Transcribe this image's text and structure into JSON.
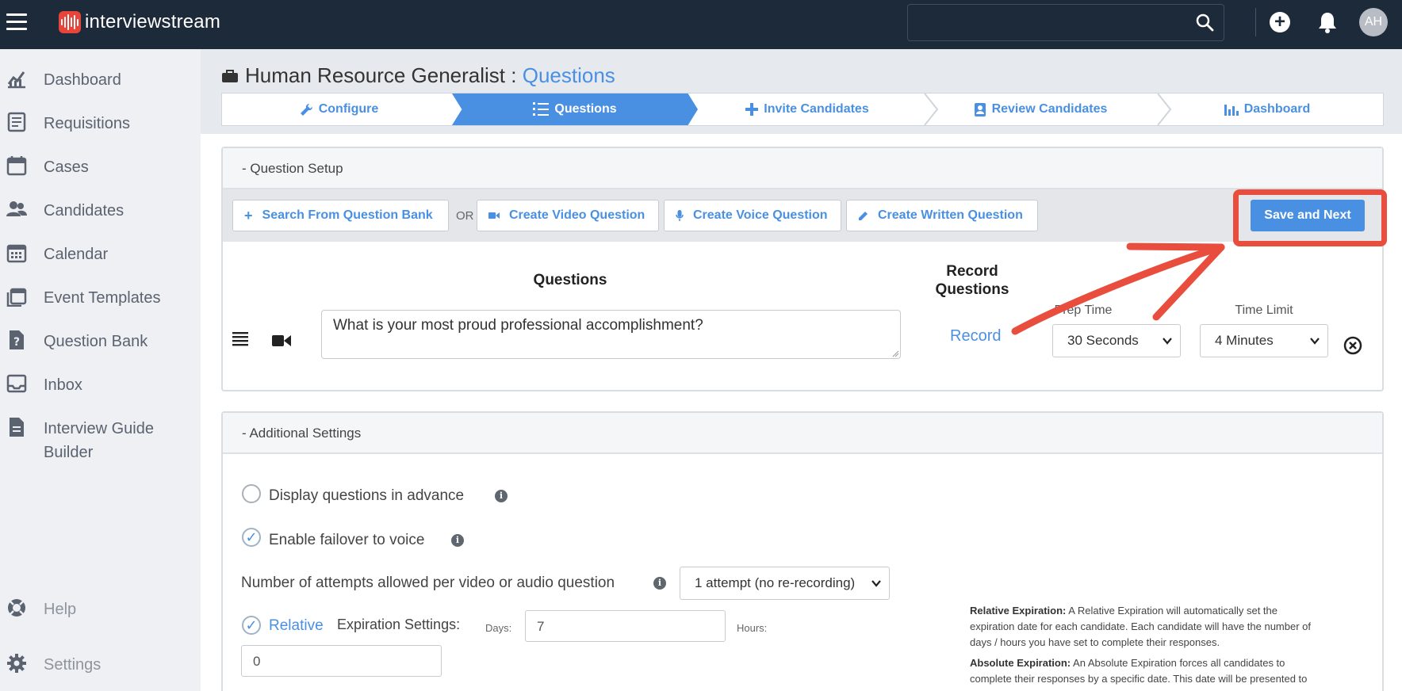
{
  "app": {
    "name": "interviewstream"
  },
  "topbar": {
    "search_value": "",
    "avatar_initials": "AH",
    "icons": [
      "menu-icon",
      "search-icon",
      "add-icon",
      "bell-icon"
    ]
  },
  "sidebar": {
    "items": [
      {
        "label": "Dashboard",
        "icon": "chart-icon"
      },
      {
        "label": "Requisitions",
        "icon": "document-list-icon"
      },
      {
        "label": "Cases",
        "icon": "calendar-icon"
      },
      {
        "label": "Candidates",
        "icon": "people-icon"
      },
      {
        "label": "Calendar",
        "icon": "calendar-grid-icon"
      },
      {
        "label": "Event Templates",
        "icon": "templates-icon"
      },
      {
        "label": "Question Bank",
        "icon": "question-file-icon"
      },
      {
        "label": "Inbox",
        "icon": "inbox-icon"
      },
      {
        "label": "Interview Guide",
        "label2": "Builder",
        "icon": "guide-icon"
      }
    ],
    "help_label": "Help",
    "settings_label": "Settings"
  },
  "page": {
    "title_prefix": "Human Resource Generalist : ",
    "title_section": "Questions"
  },
  "steps": [
    {
      "label": "Configure",
      "icon": "wrench-icon"
    },
    {
      "label": "Questions",
      "icon": "list-icon",
      "active": true
    },
    {
      "label": "Invite Candidates",
      "icon": "plus-icon"
    },
    {
      "label": "Review Candidates",
      "icon": "contact-icon"
    },
    {
      "label": "Dashboard",
      "icon": "bar-chart-icon"
    }
  ],
  "question_setup": {
    "header": "- Question Setup",
    "buttons": {
      "search_bank": "Search From Question Bank",
      "or": "OR",
      "create_video": "Create Video Question",
      "create_voice": "Create Voice Question",
      "create_written": "Create Written Question",
      "save_next": "Save and Next"
    },
    "columns": {
      "questions": "Questions",
      "record_line1": "Record",
      "record_line2": "Questions",
      "prep_time": "Prep Time",
      "time_limit": "Time Limit"
    },
    "rows": [
      {
        "text": "What is your most proud professional accomplishment?",
        "record_label": "Record",
        "prep_time": "30 Seconds",
        "time_limit": "4 Minutes"
      }
    ]
  },
  "additional_settings": {
    "header": "- Additional Settings",
    "display_in_advance": {
      "label": "Display questions in advance",
      "checked": false
    },
    "failover_voice": {
      "label": "Enable failover to voice",
      "checked": true
    },
    "attempts": {
      "label": "Number of attempts allowed per video or audio question",
      "value": "1 attempt (no re-recording)"
    },
    "expiration": {
      "relative_label": "Relative",
      "settings_label": "Expiration Settings:",
      "days_label": "Days:",
      "days_value": "7",
      "hours_label": "Hours:",
      "hours_value": "0"
    },
    "help": {
      "relative_title": "Relative Expiration:",
      "relative_line1": " A Relative Expiration will automatically set the",
      "relative_line2": "expiration date for each candidate. Each candidate will have the number of",
      "relative_line3": "days / hours you have set to complete their responses.",
      "absolute_title": "Absolute Expiration:",
      "absolute_line1": " An Absolute Expiration forces all candidates to",
      "absolute_line2": "complete their responses by a specific date. This date will be presented to"
    }
  },
  "colors": {
    "accent": "#4a90e2",
    "topbar": "#1d2a3a",
    "highlight": "#e84d3d"
  }
}
